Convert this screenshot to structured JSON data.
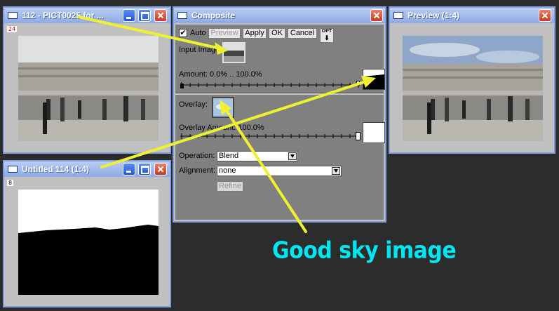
{
  "windows": {
    "source": {
      "title": "112 - PICT0025 for ...",
      "badge": "24"
    },
    "mask": {
      "title": "Untitled 114 (1:4)",
      "badge": "8"
    },
    "composite": {
      "title": "Composite",
      "auto_label": "Auto",
      "auto_checked": true,
      "preview_label": "Preview",
      "apply_label": "Apply",
      "ok_label": "OK",
      "cancel_label": "Cancel",
      "opt_label": "OPT",
      "input_image_label": "Input Image:",
      "amount_label": "Amount: 0.0% .. 100.0%",
      "overlay_label": "Overlay:",
      "overlay_amount_label": "Overlay Amount: 100.0%",
      "operation_label": "Operation:",
      "operation_value": "Blend",
      "alignment_label": "Alignment:",
      "alignment_value": "none",
      "refine_label": "Refine",
      "amount_range": [
        0.0,
        100.0
      ],
      "overlay_amount": 100.0
    },
    "preview": {
      "title": "Preview (1:4)"
    }
  },
  "annotation": {
    "text": "Good sky image",
    "color": "#00e6f0",
    "arrow_color": "#f0f032"
  },
  "colors": {
    "titlebar": "#8eaae4",
    "window_border": "#7ea0de",
    "desktop": "#2c2c2c",
    "panel": "#808080"
  }
}
